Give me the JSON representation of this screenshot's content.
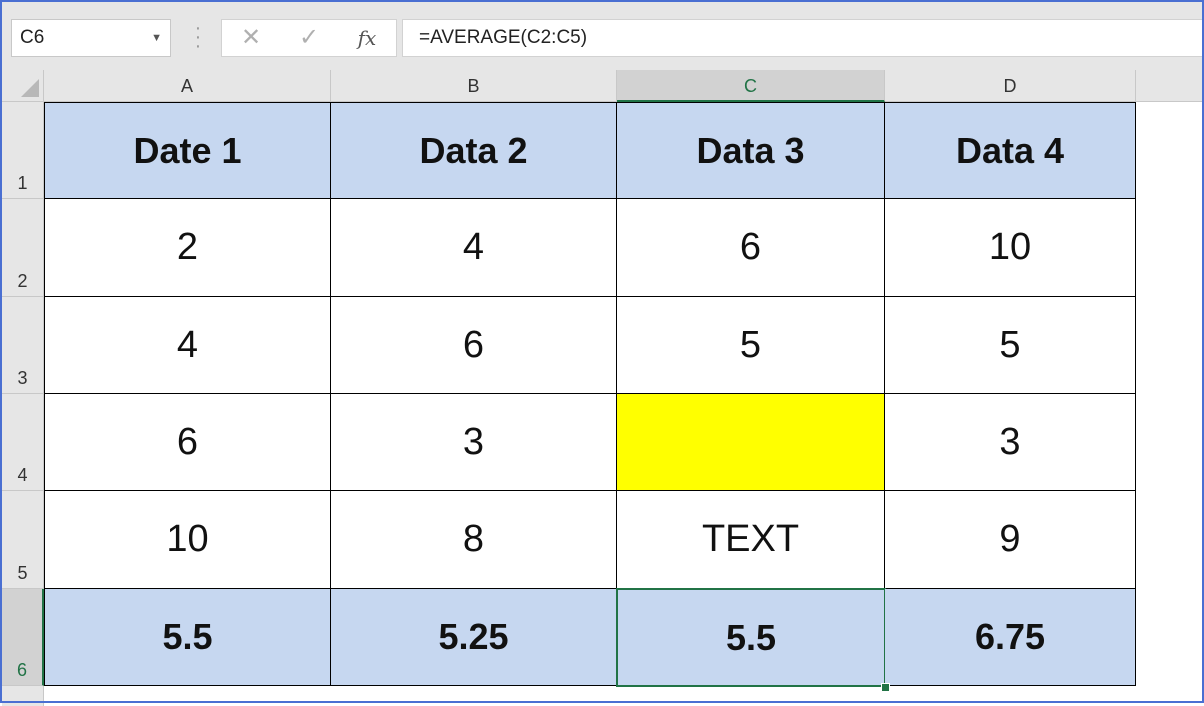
{
  "formula_bar": {
    "name_box": "C6",
    "cancel_icon": "x-icon",
    "enter_icon": "check-icon",
    "fx_label": "fx",
    "formula": "=AVERAGE(C2:C5)"
  },
  "columns": [
    "A",
    "B",
    "C",
    "D"
  ],
  "rows": [
    "1",
    "2",
    "3",
    "4",
    "5",
    "6"
  ],
  "selected_cell": "C6",
  "cells": [
    [
      "Date 1",
      "Data 2",
      "Data 3",
      "Data 4"
    ],
    [
      "2",
      "4",
      "6",
      "10"
    ],
    [
      "4",
      "6",
      "5",
      "5"
    ],
    [
      "6",
      "3",
      "",
      "3"
    ],
    [
      "10",
      "8",
      "TEXT",
      "9"
    ],
    [
      "5.5",
      "5.25",
      "5.5",
      "6.75"
    ]
  ],
  "colors": {
    "header_fill": "#c6d7f0",
    "highlight_fill": "#ffff00",
    "selection": "#217346"
  }
}
